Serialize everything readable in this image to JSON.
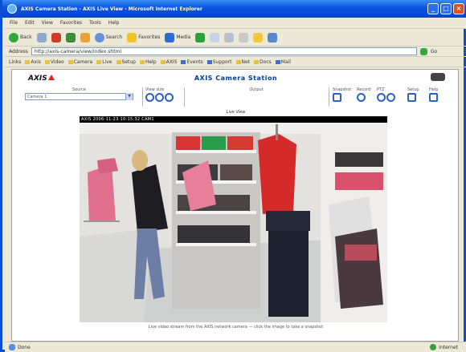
{
  "window": {
    "title": "AXIS Camera Station - AXIS Live View - Microsoft Internet Explorer"
  },
  "menu": [
    "File",
    "Edit",
    "View",
    "Favorites",
    "Tools",
    "Help"
  ],
  "toolbar": {
    "back": "Back",
    "search": "Search",
    "favorites": "Favorites",
    "media": "Media"
  },
  "address": {
    "label": "Address",
    "url": "http://axis-camera/view/index.shtml",
    "go": "Go"
  },
  "links_label": "Links",
  "links": [
    "Axis",
    "Video",
    "Camera",
    "Live",
    "Setup",
    "Help",
    "AXIS",
    "Events",
    "Support",
    "Net",
    "Docs",
    "Mail"
  ],
  "page": {
    "logo": "AXIS",
    "title": "AXIS Camera Station",
    "group_source": "Source",
    "source_value": "Camera 1",
    "group_view": "View size",
    "group_output": "Output",
    "group_snapshot": "Snapshot",
    "group_record": "Record",
    "group_ptz": "PTZ",
    "group_setup": "Setup",
    "group_help": "Help",
    "video_title": "Live View",
    "osd": "AXIS  2006-11-23  10:15:32  CAM1",
    "footer": "Live video stream from the AXIS network camera — click the image to take a snapshot"
  },
  "status": {
    "text": "Done",
    "zone": "Internet"
  },
  "colors": {
    "accent": "#003aa8",
    "brand_red": "#e31e24",
    "titlebar": "#0a52e0"
  }
}
